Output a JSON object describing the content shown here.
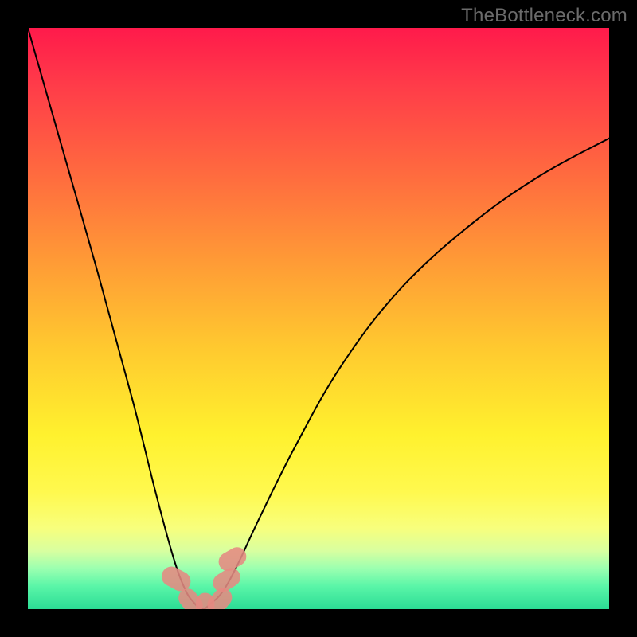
{
  "watermark": "TheBottleneck.com",
  "chart_data": {
    "type": "line",
    "title": "",
    "xlabel": "",
    "ylabel": "",
    "xlim": [
      0,
      100
    ],
    "ylim": [
      0,
      100
    ],
    "grid": false,
    "series": [
      {
        "name": "curve",
        "x": [
          0,
          6,
          12,
          18,
          22,
          25,
          27,
          28.5,
          30,
          31.5,
          33.5,
          36,
          40,
          46,
          54,
          64,
          76,
          88,
          100
        ],
        "y": [
          100,
          79,
          58,
          36,
          20,
          9,
          3.5,
          1.2,
          0,
          1.0,
          3.0,
          7.5,
          16,
          28,
          42,
          55,
          66,
          74.5,
          81
        ]
      }
    ],
    "markers": [
      {
        "x": 25.5,
        "y": 5.2,
        "rx": 1.7,
        "ry": 2.6,
        "angle": -62
      },
      {
        "x": 28.0,
        "y": 1.3,
        "rx": 1.6,
        "ry": 2.4,
        "angle": -38
      },
      {
        "x": 30.5,
        "y": 0.5,
        "rx": 1.6,
        "ry": 2.3,
        "angle": 0
      },
      {
        "x": 33.0,
        "y": 1.4,
        "rx": 1.6,
        "ry": 2.4,
        "angle": 40
      },
      {
        "x": 34.2,
        "y": 5.0,
        "rx": 1.6,
        "ry": 2.5,
        "angle": 58
      },
      {
        "x": 35.2,
        "y": 8.6,
        "rx": 1.6,
        "ry": 2.5,
        "angle": 60
      }
    ]
  }
}
